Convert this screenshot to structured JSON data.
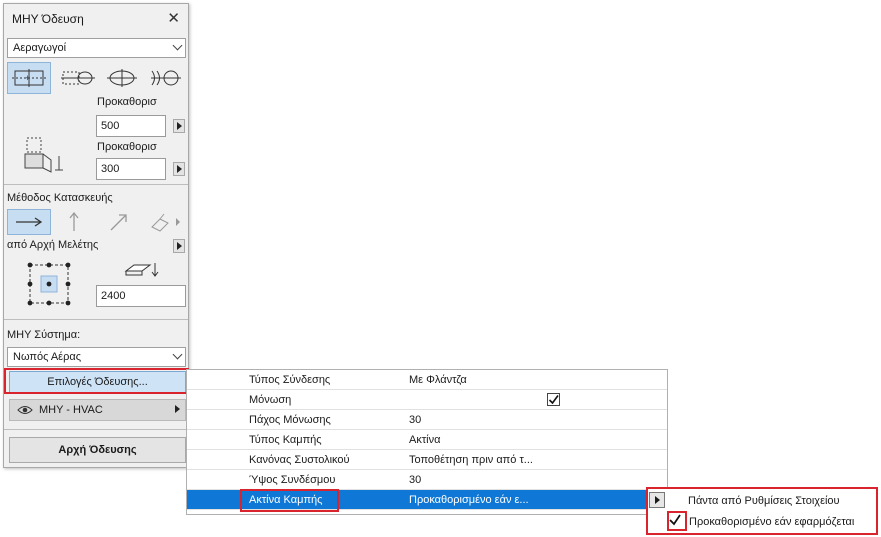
{
  "panel": {
    "title": "ΜΗΥ Όδευση",
    "category_value": "Αεραγωγοί",
    "label_default_1": "Προκαθορισ",
    "value_width": "500",
    "label_default_2": "Προκαθορισ",
    "value_height": "300",
    "method_label": "Μέθοδος Κατασκευής",
    "reference_label": "από Αρχή Μελέτης",
    "elevation_value": "2400",
    "system_label": "ΜΗΥ Σύστημα:",
    "system_value": "Νωπός Αέρας",
    "routing_options_button": "Επιλογές Όδευσης...",
    "layer_label": "ΜΗΥ - HVAC",
    "start_routing_button": "Αρχή Όδευσης"
  },
  "properties": [
    {
      "key": "Τύπος Σύνδεσης",
      "value": "Με Φλάντζα"
    },
    {
      "key": "Μόνωση",
      "value": ""
    },
    {
      "key": "Πάχος Μόνωσης",
      "value": "30"
    },
    {
      "key": "Τύπος Καμπής",
      "value": "Ακτίνα"
    },
    {
      "key": "Κανόνας Συστολικού",
      "value": "Τοποθέτηση πριν από τ..."
    },
    {
      "key": "Ύψος Συνδέσμου",
      "value": "30"
    },
    {
      "key": "Ακτίνα Καμπής",
      "value": "Προκαθορισμένο εάν ε..."
    }
  ],
  "options": {
    "option_1": "Πάντα από Ρυθμίσεις Στοιχείου",
    "option_2": "Προκαθορισμένο εάν εφαρμόζεται"
  },
  "colors": {
    "highlight": "#0f78d7",
    "callout": "#d9232d",
    "selected_tool": "#c7ddf2"
  }
}
